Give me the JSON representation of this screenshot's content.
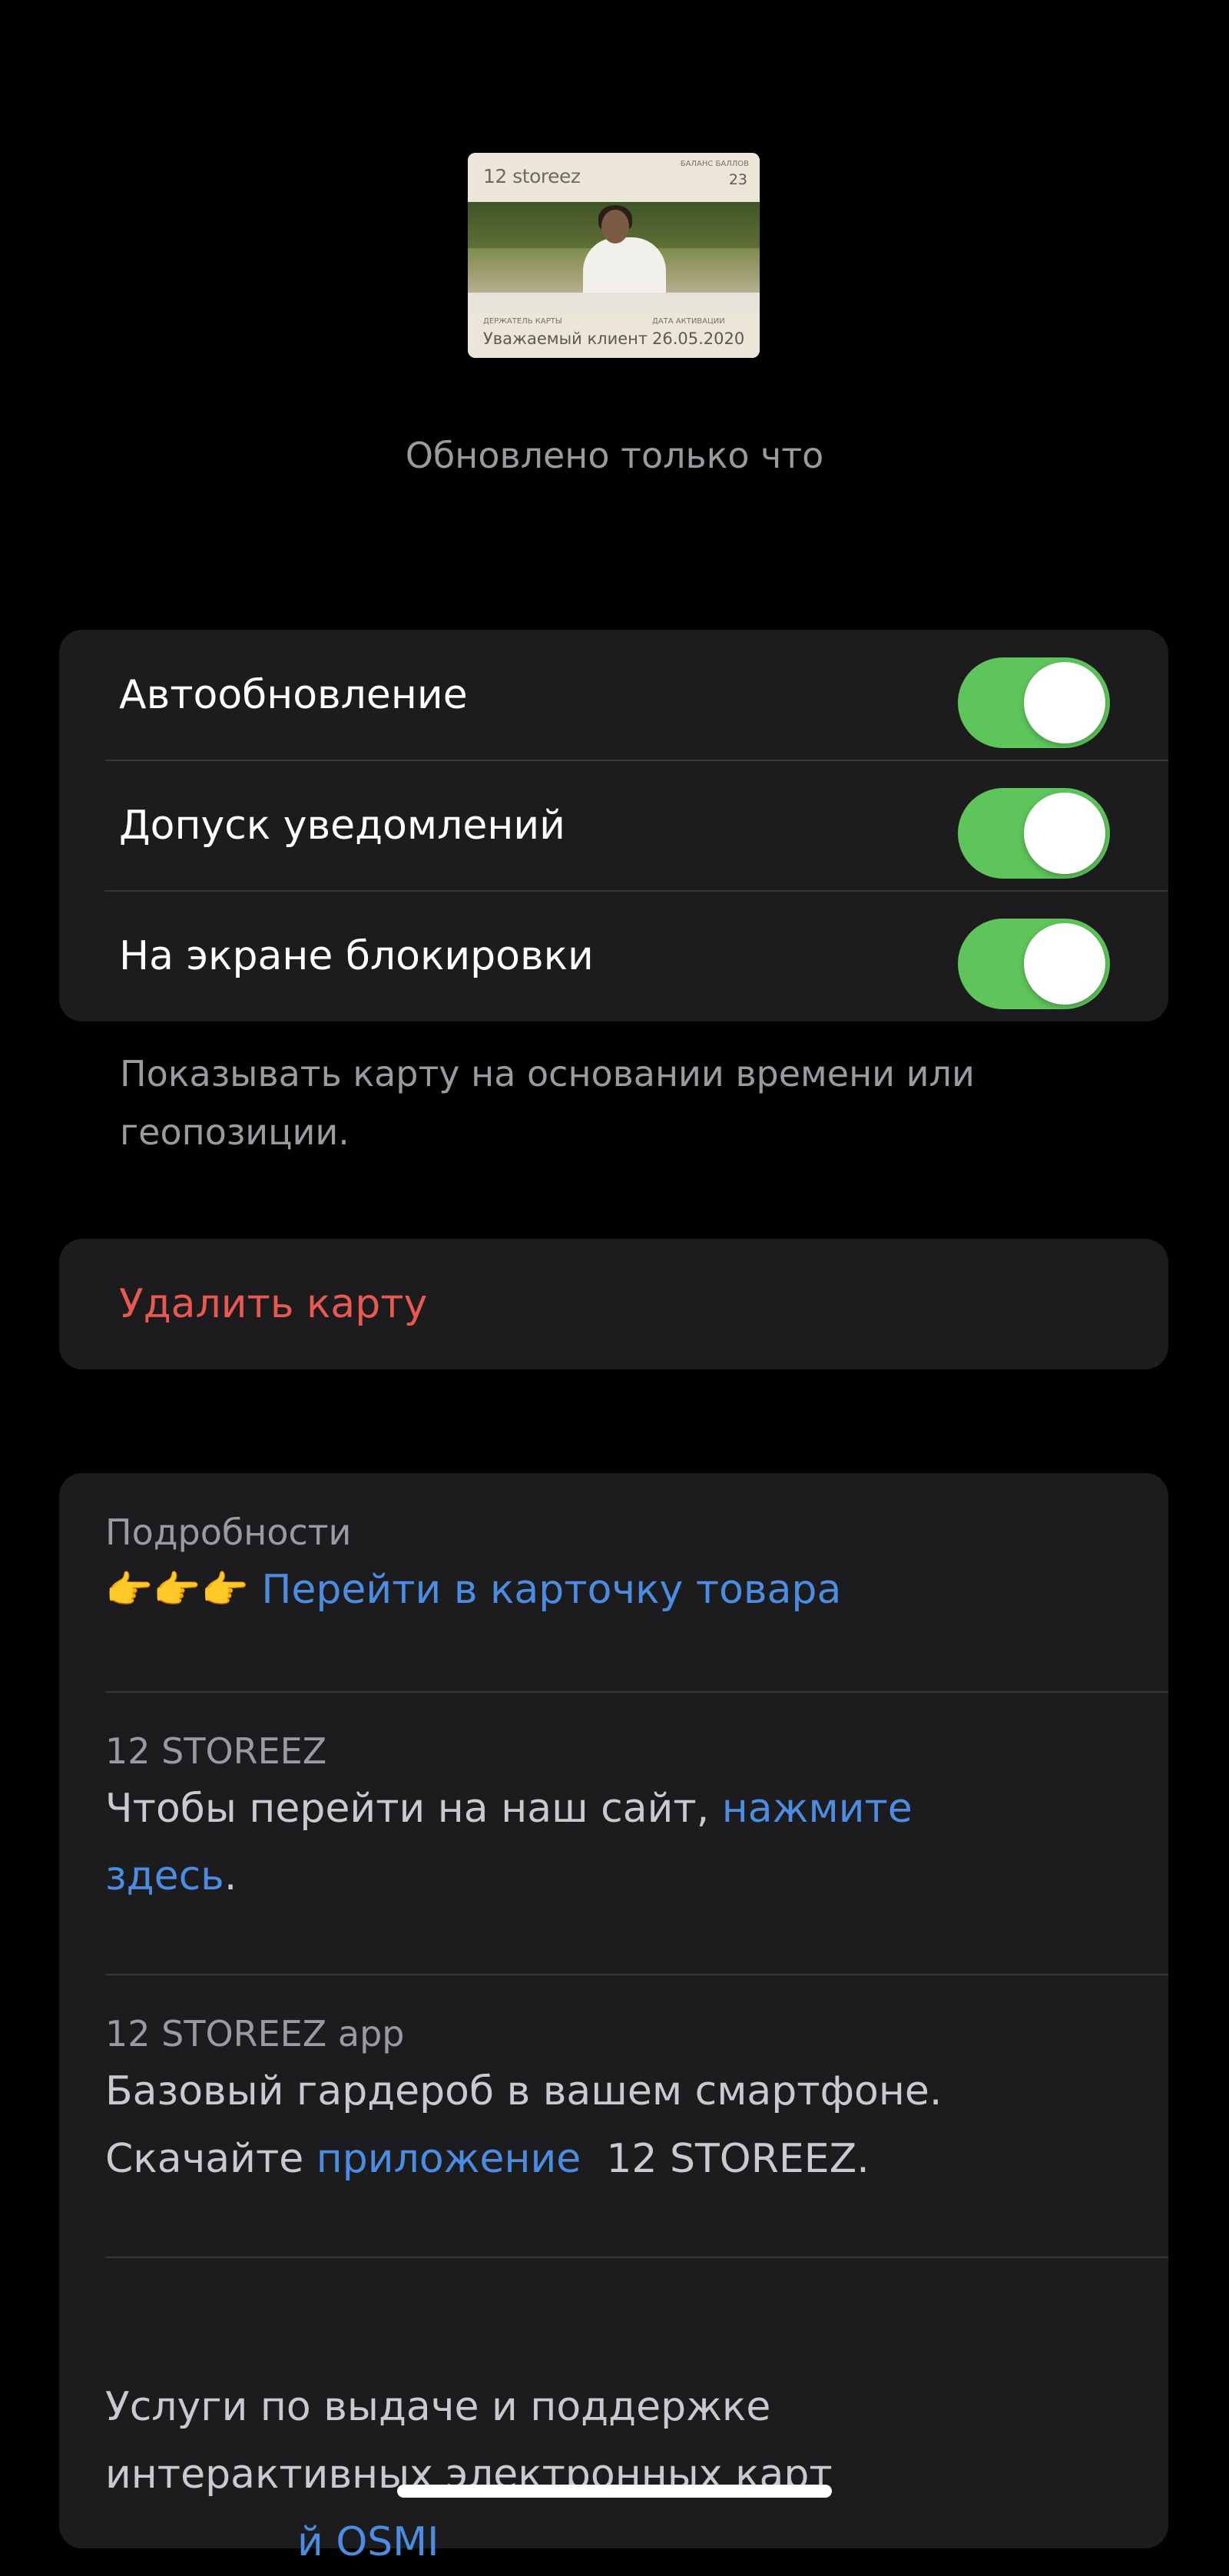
{
  "card": {
    "brand": "12 storeez",
    "balance_caption": "БАЛАНС БАЛЛОВ",
    "balance": "23",
    "holder_caption": "ДЕРЖАТЕЛЬ КАРТЫ",
    "holder": "Уважаемый клиент",
    "date_caption": "ДАТА АКТИВАЦИИ",
    "date": "26.05.2020"
  },
  "updated_text": "Обновлено только что",
  "toggles": [
    {
      "label": "Автообновление",
      "on": true
    },
    {
      "label": "Допуск уведомлений",
      "on": true
    },
    {
      "label": "На экране блокировки",
      "on": true
    }
  ],
  "toggle_color": "#5ec55a",
  "lock_screen_note": "Показывать карту на основании времени или геопозиции.",
  "delete_label": "Удалить карту",
  "details": {
    "heading": "Подробности",
    "emoji": "👉👉👉",
    "product_link": "Перейти в карточку товара",
    "site": {
      "caption": "12 STOREEZ",
      "text_before": "Чтобы перейти на наш сайт, ",
      "link": "нажмите здесь",
      "text_after": "."
    },
    "app": {
      "caption": "12 STOREEZ app",
      "line1": "Базовый гардероб в вашем смартфоне.",
      "text_before": "Скачайте ",
      "link": "приложение",
      "text_after": "  12 STOREEZ."
    },
    "services_text": "Услуги по выдаче и поддержке интерактивных электронных карт",
    "services_link_partial": "й OSMI"
  }
}
